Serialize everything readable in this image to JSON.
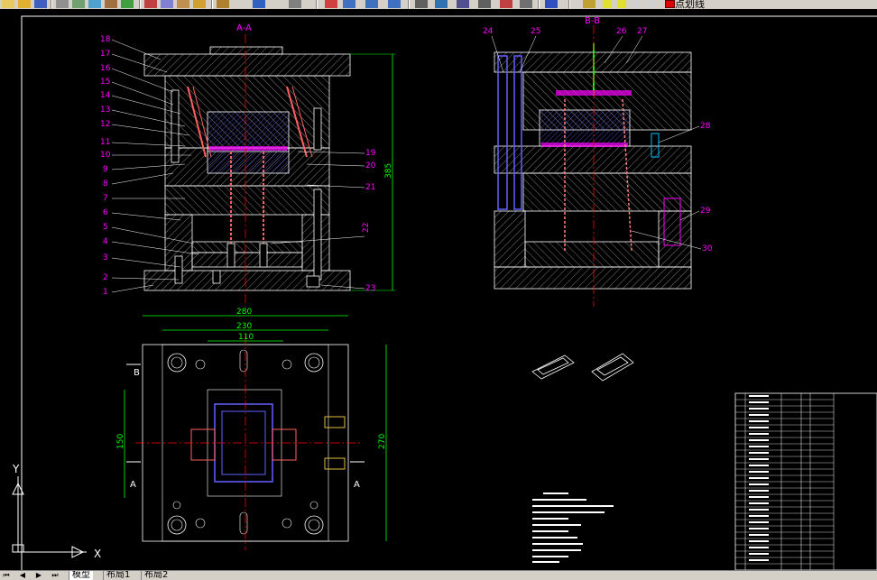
{
  "toolbar": {
    "layer_name": "点划线",
    "layer_color": "#e00000"
  },
  "views": {
    "front_title": "A-A",
    "side_title": "B-B",
    "section_mark": "A",
    "section_mark_b": "B"
  },
  "dimensions": {
    "width_280": "280",
    "width_230": "230",
    "width_110": "110",
    "height_150": "150",
    "height_270": "270",
    "height_385": "385"
  },
  "part_numbers_left": [
    "18",
    "17",
    "16",
    "15",
    "14",
    "13",
    "12",
    "11",
    "10",
    "9",
    "8",
    "7",
    "6",
    "5",
    "4",
    "3",
    "2",
    "1"
  ],
  "part_numbers_right": [
    "19",
    "20",
    "21",
    "22",
    "23"
  ],
  "part_numbers_side": [
    "24",
    "25",
    "26",
    "27",
    "28",
    "29",
    "30"
  ],
  "ucs": {
    "x_label": "X",
    "y_label": "Y"
  },
  "tabs": {
    "model": "模型",
    "layout1": "布局1",
    "layout2": "布局2"
  },
  "colors": {
    "steel_gray": "#c0c0c0",
    "dim_green": "#00ff00",
    "leader_magenta": "#ff00ff",
    "center_red": "#ff0000",
    "cavity_blue": "#6060ff"
  }
}
